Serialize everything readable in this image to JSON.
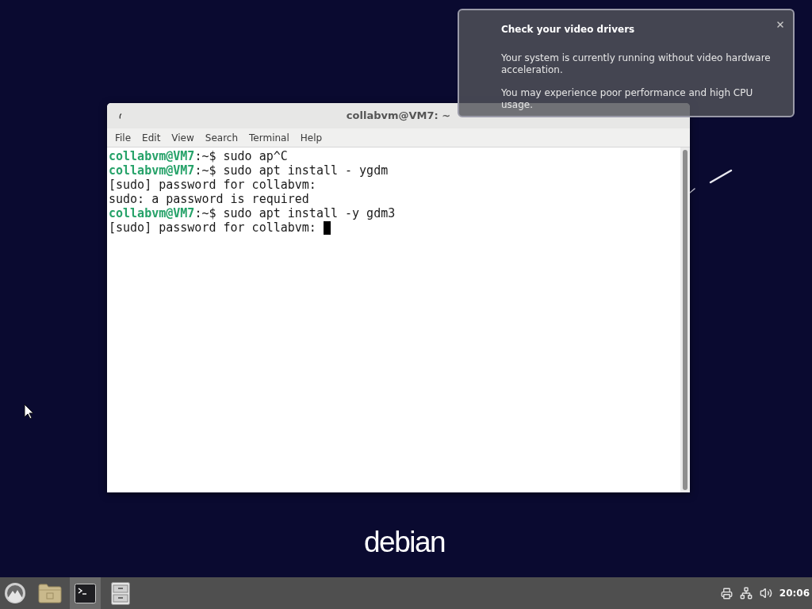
{
  "desktop": {
    "logo": "debian"
  },
  "terminal_window": {
    "title": "collabvm@VM7: ~",
    "menu": [
      "File",
      "Edit",
      "View",
      "Search",
      "Terminal",
      "Help"
    ],
    "lines": [
      {
        "kind": "prompt",
        "user_host": "collabvm@VM7",
        "path": ":~$",
        "command": "sudo ap^C"
      },
      {
        "kind": "prompt",
        "user_host": "collabvm@VM7",
        "path": ":~$",
        "command": "sudo apt install - ygdm"
      },
      {
        "kind": "output",
        "text": "[sudo] password for collabvm:"
      },
      {
        "kind": "output",
        "text": "sudo: a password is required"
      },
      {
        "kind": "prompt",
        "user_host": "collabvm@VM7",
        "path": ":~$",
        "command": "sudo apt install -y gdm3"
      },
      {
        "kind": "output",
        "text": "[sudo] password for collabvm:"
      }
    ]
  },
  "notification": {
    "title": "Check your video drivers",
    "paragraphs": [
      "Your system is currently running without video hardware acceleration.",
      "You may experience poor performance and high CPU usage."
    ]
  },
  "taskbar": {
    "launchers": [
      {
        "kind": "menu",
        "selected": false
      },
      {
        "kind": "folder",
        "selected": false
      },
      {
        "kind": "terminal",
        "selected": true
      },
      {
        "kind": "cabinet",
        "selected": false
      }
    ],
    "clock": "20:06"
  }
}
